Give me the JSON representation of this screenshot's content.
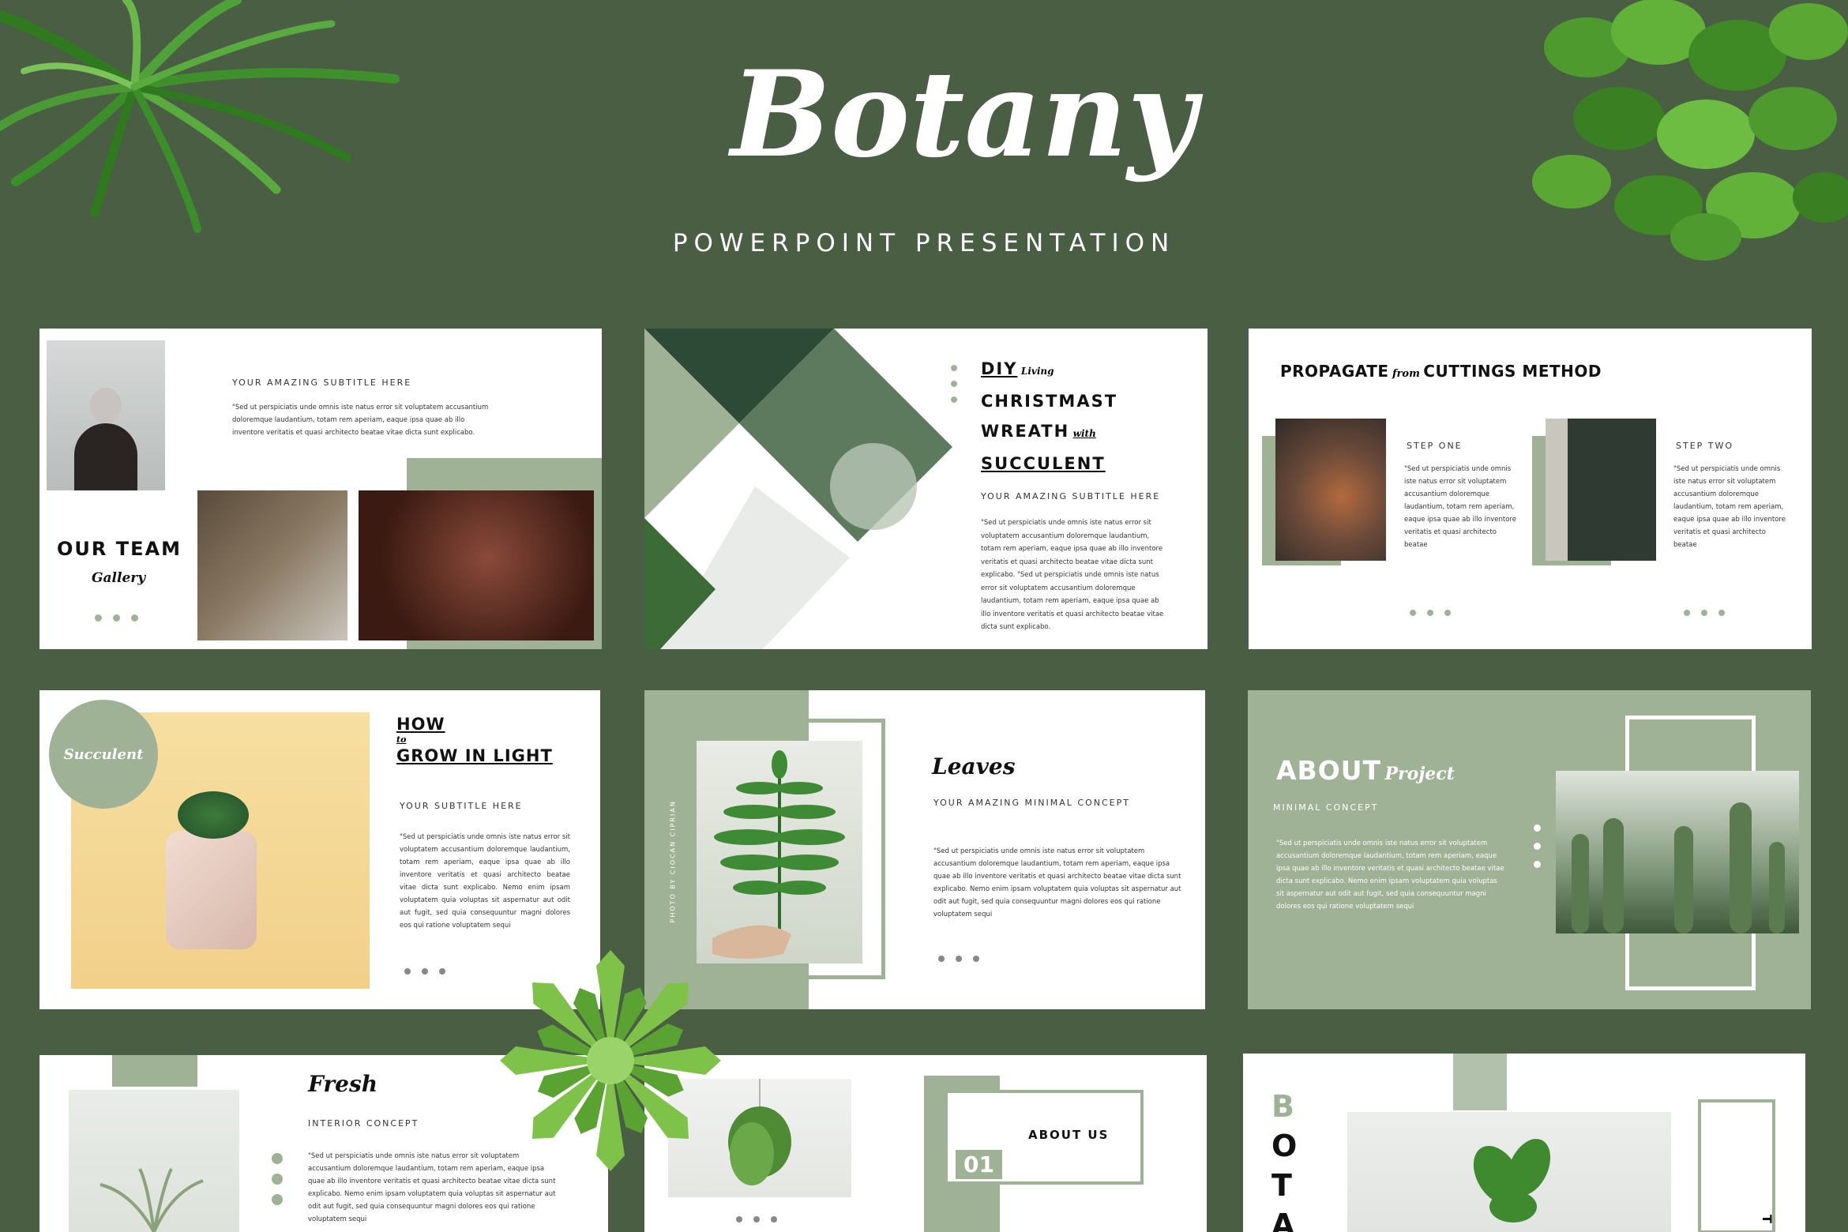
{
  "header": {
    "title": "Botany",
    "subtitle": "POWERPOINT PRESENTATION"
  },
  "colors": {
    "background": "#4a5e44",
    "sage": "#9fb296",
    "slide": "#ffffff",
    "text": "#111111"
  },
  "slides": {
    "team": {
      "heading": "OUR TEAM",
      "script": "Gallery",
      "subtitle": "YOUR AMAZING SUBTITLE HERE",
      "body": "\"Sed ut perspiciatis unde omnis iste natus error sit voluptatem accusantium doloremque laudantium, totam rem aperiam, eaque ipsa quae ab illo inventore veritatis et quasi architecto beatae vitae dicta sunt explicabo."
    },
    "diy": {
      "line1": "DIY",
      "line1_script": "Living",
      "line2": "CHRISTMAST",
      "line3": "WREATH",
      "line3_script": "with",
      "line4": "SUCCULENT",
      "subtitle": "YOUR AMAZING SUBTITLE HERE",
      "body": "\"Sed ut perspiciatis unde omnis iste natus error sit voluptatem accusantium doloremque laudantium, totam rem aperiam, eaque ipsa quae ab illo inventore veritatis et quasi architecto beatae vitae dicta sunt explicabo. \"Sed ut perspiciatis unde omnis iste natus error sit voluptatem accusantium doloremque laudantium, totam rem aperiam, eaque ipsa quae ab illo inventore veritatis et quasi architecto beatae vitae dicta sunt explicabo."
    },
    "propagate": {
      "title_left": "PROPAGATE",
      "title_script": "from",
      "title_right": "CUTTINGS METHOD",
      "step1_label": "STEP ONE",
      "step1_body": "\"Sed ut perspiciatis unde omnis iste natus error sit voluptatem accusantium doloremque laudantium, totam rem aperiam, eaque ipsa quae ab illo inventore veritatis et quasi architecto beatae",
      "step2_label": "STEP TWO",
      "step2_body": "\"Sed ut perspiciatis unde omnis iste natus error sit voluptatem accusantium doloremque laudantium, totam rem aperiam, eaque ipsa quae ab illo inventore veritatis et quasi architecto beatae"
    },
    "light": {
      "badge": "Succulent",
      "line1": "HOW",
      "line2": "to",
      "line3": "GROW IN LIGHT",
      "subtitle": "YOUR SUBTITLE HERE",
      "body": "\"Sed ut perspiciatis unde omnis iste natus error sit voluptatem accusantium doloremque laudantium, totam rem aperiam, eaque ipsa quae ab illo inventore veritatis et quasi architecto beatae vitae dicta sunt explicabo. Nemo enim ipsam voluptatem quia voluptas sit aspernatur aut odit aut fugit, sed quia consequuntur magni dolores eos qui ratione voluptatem sequi"
    },
    "leaves": {
      "title": "Leaves",
      "subtitle": "YOUR AMAZING MINIMAL CONCEPT",
      "credit": "PHOTO BY CIOCAN CIPRIAN",
      "body": "\"Sed ut perspiciatis unde omnis iste natus error sit voluptatem accusantium doloremque laudantium, totam rem aperiam, eaque ipsa quae ab illo inventore veritatis et quasi architecto beatae vitae dicta sunt explicabo. Nemo enim ipsam voluptatem quia voluptas sit aspernatur aut odit aut fugit, sed quia consequuntur magni dolores eos qui ratione voluptatem sequi"
    },
    "about_project": {
      "title": "ABOUT",
      "title_script": "Project",
      "subtitle": "MINIMAL CONCEPT",
      "body": "\"Sed ut perspiciatis unde omnis iste natus error sit voluptatem accusantium doloremque laudantium, totam rem aperiam, eaque ipsa quae ab illo inventore veritatis et quasi architecto beatae vitae dicta sunt explicabo. Nemo enim ipsam voluptatem quia voluptas sit aspernatur aut odit aut fugit, sed quia consequuntur magni dolores eos qui ratione voluptatem sequi"
    },
    "fresh": {
      "title": "Fresh",
      "subtitle": "INTERIOR CONCEPT",
      "body": "\"Sed ut perspiciatis unde omnis iste natus error sit voluptatem accusantium doloremque laudantium, totam rem aperiam, eaque ipsa quae ab illo inventore veritatis et quasi architecto beatae vitae dicta sunt explicabo. Nemo enim ipsam voluptatem quia voluptas sit aspernatur aut odit aut fugit, sed quia consequuntur magni dolores eos qui ratione voluptatem sequi"
    },
    "about_us": {
      "number": "01",
      "title": "ABOUT US"
    },
    "botany": {
      "letters": [
        "B",
        "O",
        "T",
        "A"
      ],
      "side_letter": "T"
    }
  }
}
